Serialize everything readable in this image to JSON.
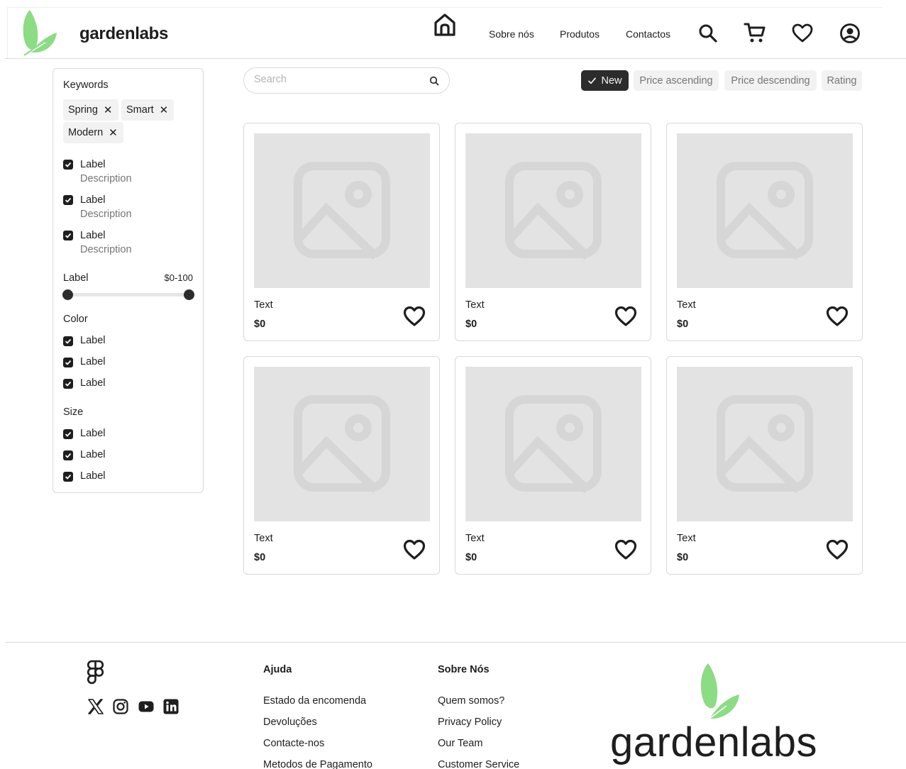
{
  "brand": {
    "name": "gardenlabs",
    "accent": "#8bdc83"
  },
  "nav": {
    "links": [
      "Sobre nós",
      "Produtos",
      "Contactos"
    ],
    "icons": [
      "home-icon",
      "search-icon",
      "cart-icon",
      "heart-icon",
      "user-icon"
    ]
  },
  "filters": {
    "keywords_title": "Keywords",
    "tags": [
      "Spring",
      "Smart",
      "Modern"
    ],
    "tag_remove": "✕",
    "options": [
      {
        "label": "Label",
        "description": "Description",
        "checked": true
      },
      {
        "label": "Label",
        "description": "Description",
        "checked": true
      },
      {
        "label": "Label",
        "description": "Description",
        "checked": true
      }
    ],
    "range": {
      "label": "Label",
      "value": "$0-100",
      "min_fraction": 0,
      "max_fraction": 1
    },
    "color": {
      "title": "Color",
      "items": [
        "Label",
        "Label",
        "Label"
      ]
    },
    "size": {
      "title": "Size",
      "items": [
        "Label",
        "Label",
        "Label"
      ]
    }
  },
  "search": {
    "placeholder": "Search",
    "value": ""
  },
  "sort": {
    "options": [
      "New",
      "Price ascending",
      "Price descending",
      "Rating"
    ],
    "selected": "New"
  },
  "products": [
    {
      "title": "Text",
      "price": "$0"
    },
    {
      "title": "Text",
      "price": "$0"
    },
    {
      "title": "Text",
      "price": "$0"
    },
    {
      "title": "Text",
      "price": "$0"
    },
    {
      "title": "Text",
      "price": "$0"
    },
    {
      "title": "Text",
      "price": "$0"
    }
  ],
  "footer": {
    "social": [
      "figma-icon",
      "x-icon",
      "instagram-icon",
      "youtube-icon",
      "linkedin-icon"
    ],
    "help": {
      "title": "Ajuda",
      "links": [
        "Estado da encomenda",
        "Devoluções",
        "Contacte-nos",
        "Metodos de Pagamento"
      ]
    },
    "about": {
      "title": "Sobre Nós",
      "links": [
        "Quem somos?",
        "Privacy Policy",
        "Our Team",
        "Customer Service"
      ]
    },
    "brand": "gardenlabs"
  }
}
